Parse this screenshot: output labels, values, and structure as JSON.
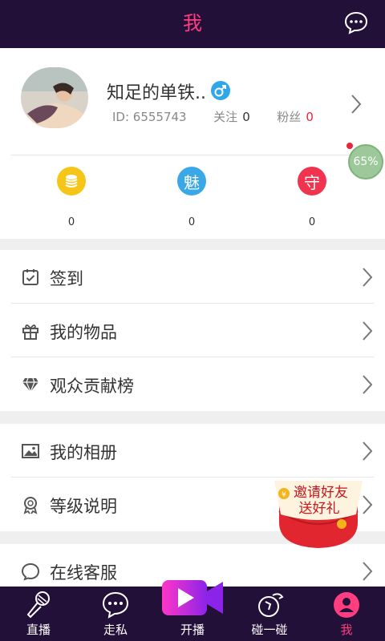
{
  "header": {
    "title": "我"
  },
  "profile": {
    "nickname": "知足的单铁..",
    "id_label": "ID: 6555743",
    "following_label": "关注",
    "following_count": "0",
    "fans_label": "粉丝",
    "fans_count": "0",
    "gender": "male"
  },
  "stats": [
    {
      "icon": "coins-icon",
      "value": "0",
      "color": "#f5c518"
    },
    {
      "icon": "charm-icon",
      "value": "0",
      "color": "#3aa7e6"
    },
    {
      "icon": "guard-icon",
      "value": "0",
      "color": "#f0334e"
    }
  ],
  "progress": {
    "label": "65%",
    "value": 0.65
  },
  "menu": {
    "group1": [
      "签到",
      "我的物品",
      "观众贡献榜"
    ],
    "group2": [
      "我的相册",
      "等级说明"
    ],
    "group3": [
      "在线客服"
    ]
  },
  "invite": {
    "line1": "邀请好友",
    "line2": "送好礼"
  },
  "tabs": [
    {
      "label": "直播",
      "icon": "microphone-icon"
    },
    {
      "label": "走私",
      "icon": "chat-bubble-icon"
    },
    {
      "label": "开播",
      "icon": "video-camera-icon"
    },
    {
      "label": "碰一碰",
      "icon": "dice-icon"
    },
    {
      "label": "我",
      "icon": "user-icon",
      "active": true
    }
  ],
  "colors": {
    "accent": "#ff3d7f",
    "nav_bg": "#221039"
  }
}
